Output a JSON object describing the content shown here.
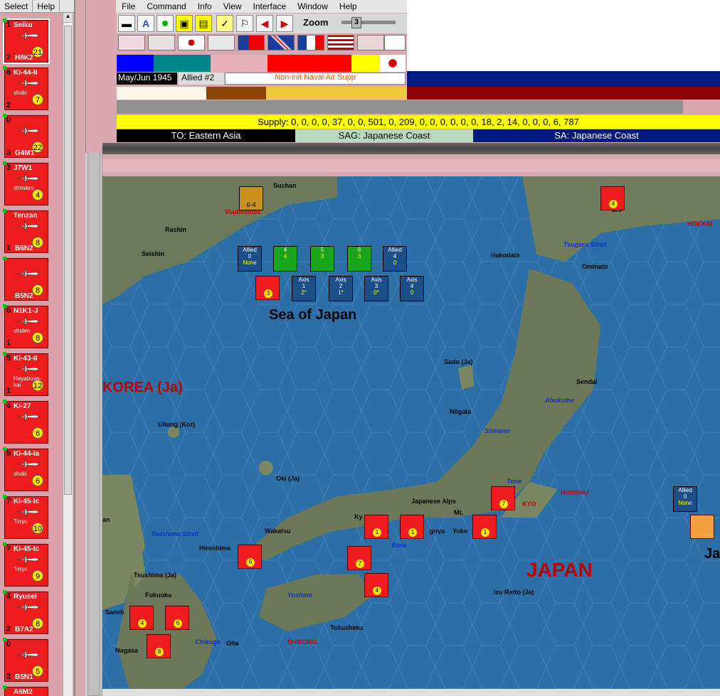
{
  "left_menu": [
    "Select",
    "Help"
  ],
  "units": [
    {
      "tl": "1",
      "name": "Seiku",
      "sub": "",
      "bot": "2",
      "code": "H8K2",
      "badge": "21",
      "selected": true
    },
    {
      "tl": "6",
      "name": "Ki-44-II",
      "sub": "shoki",
      "bot": "2",
      "code": "",
      "badge": "7"
    },
    {
      "tl": "0",
      "name": "",
      "sub": "",
      "bot": "3",
      "code": "G4M1",
      "badge": "22"
    },
    {
      "tl": "3",
      "name": "J7W1",
      "sub": "shinden",
      "bot": "",
      "code": "",
      "badge": "4"
    },
    {
      "tl": "",
      "name": "Tenzan",
      "sub": "",
      "bot": "1",
      "code": "B6N2",
      "badge": "8"
    },
    {
      "tl": "",
      "name": "",
      "sub": "",
      "bot": "",
      "code": "B5N2",
      "badge": "8"
    },
    {
      "tl": "6",
      "name": "N1K1-J",
      "sub": "shiden",
      "bot": "1",
      "code": "",
      "badge": "8"
    },
    {
      "tl": "5",
      "name": "Ki-43-II",
      "sub": "Hayabusa-kai",
      "bot": "1",
      "code": "",
      "badge": "12"
    },
    {
      "tl": "4",
      "name": "Ki-27",
      "sub": "",
      "bot": "",
      "code": "",
      "badge": "6"
    },
    {
      "tl": "5",
      "name": "Ki-44-Ia",
      "sub": "shoki",
      "bot": "",
      "code": "",
      "badge": "6"
    },
    {
      "tl": "7",
      "name": "Ki-45-Ic",
      "sub": "Toryu",
      "bot": "",
      "code": "",
      "badge": "10"
    },
    {
      "tl": "7",
      "name": "Ki-45-Ic",
      "sub": "Toryu",
      "bot": "",
      "code": "",
      "badge": "9"
    },
    {
      "tl": "4",
      "name": "Ryusei",
      "sub": "",
      "bot": "2",
      "code": "B7A2",
      "badge": "8"
    },
    {
      "tl": "0",
      "name": "",
      "sub": "",
      "bot": "2",
      "code": "B5N1",
      "badge": "5"
    },
    {
      "tl": "",
      "name": "A6M2",
      "sub": "",
      "bot": "",
      "code": "",
      "badge": ""
    }
  ],
  "menu": [
    "File",
    "Command",
    "Info",
    "View",
    "Interface",
    "Window",
    "Help"
  ],
  "toolbar": {
    "zoom_label": "Zoom",
    "zoom_value": "3"
  },
  "status": {
    "date": "May/Jun 1945",
    "side": "Allied #2",
    "naval": "Non-init Naval Air Supp",
    "supply": "Supply: 0, 0, 0, 0, 37, 0, 0, 501, 0, 209, 0, 0, 0, 0, 0, 0, 18, 2, 14, 0, 0, 0, 6, 787",
    "theatre": "TO: Eastern Asia",
    "sag": "SAG: Japanese Coast",
    "sa": "SA: Japanese Coast"
  },
  "map_labels": {
    "sea_of_japan": "Sea of Japan",
    "japan": "JAPAN",
    "korea": "KOREA (Ja)",
    "vladivostok": "Vladivostok",
    "suchan": "Suchan",
    "rashin": "Rashin",
    "seishin": "Seishin",
    "hakodate": "Hakodate",
    "tsugaru": "Tsugaru Strait",
    "ominato": "Ominato",
    "hokkaido": "HOKKAI",
    "sado": "Sado (Ja)",
    "sendai": "Sendai",
    "abukuma": "Abukuma",
    "niigata": "Niigata",
    "shinano": "Shinano",
    "ullung": "Ullung (Kor)",
    "oki": "Oki (Ja)",
    "tone": "Tone",
    "tokyo": "KYO",
    "honshu": "HONSHU",
    "japanese_alps": "Japanese Alps",
    "tsushima_strait": "Tsushima Strait",
    "wakatsu": "Wakatsu",
    "hiroshima": "Hiroshima",
    "biwa": "Biwa",
    "tsushima": "Tsushima (Ja)",
    "fukuoka": "Fukuoka",
    "yoshino": "Yoshino",
    "izu": "Izu Retto (Ja)",
    "saseb": "Saseb",
    "chikugo": "Chikugo",
    "oita": "Oita",
    "shikoku": "SHIKOKU",
    "tokushima": "Tokushima",
    "nagasa": "Nagasa",
    "ja": "Ja",
    "kyo_w": "Ky",
    "yoko": "Yoko",
    "nagoya": "goya",
    "nan": "an",
    "aro": "aro",
    "mt": "Mt.",
    "ka": "ka"
  },
  "box_counters": [
    {
      "top": "Allied",
      "mid": "0",
      "bot": "None",
      "style": "empty"
    },
    {
      "top": "",
      "mid": "4",
      "bot": "4",
      "style": "green"
    },
    {
      "top": "",
      "mid": "5",
      "bot": "3",
      "style": "green"
    },
    {
      "top": "",
      "mid": "6",
      "bot": "3",
      "style": "green"
    },
    {
      "top": "Allied",
      "mid": "4",
      "bot": "0",
      "style": "empty"
    },
    {
      "top": "Axis",
      "mid": "1",
      "bot": "2*",
      "style": "empty"
    },
    {
      "top": "Axis",
      "mid": "2",
      "bot": "1*",
      "style": "empty"
    },
    {
      "top": "Axis",
      "mid": "3",
      "bot": "0*",
      "style": "empty"
    },
    {
      "top": "Axis",
      "mid": "4",
      "bot": "0",
      "style": "empty"
    },
    {
      "top": "Allied",
      "mid": "0",
      "bot": "None",
      "style": "empty"
    }
  ],
  "soviet_counter": {
    "bot": "6-4"
  },
  "colors": {
    "sea": "#2c6fa6",
    "japanese_unit": "#ee1c1c",
    "supply_yellow": "#ffff00",
    "sa_blue": "#001a80"
  }
}
